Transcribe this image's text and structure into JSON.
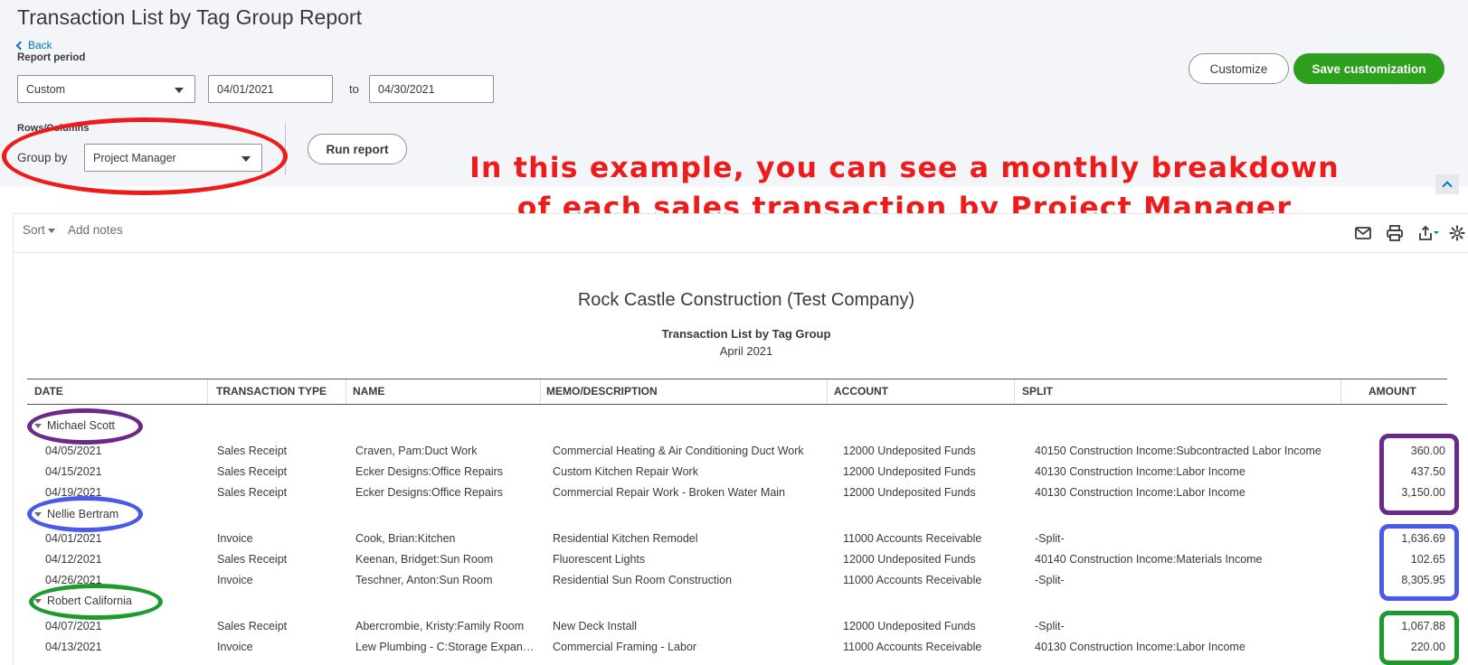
{
  "page": {
    "title": "Transaction List by Tag Group Report",
    "back_label": "Back",
    "report_period_label": "Report period",
    "period_select": "Custom",
    "date_from": "04/01/2021",
    "date_to": "04/30/2021",
    "to_label": "to",
    "rows_columns_label": "Rows/Columns",
    "group_by_label": "Group by",
    "group_by_value": "Project Manager",
    "run_report_label": "Run report",
    "customize_label": "Customize",
    "save_customization_label": "Save customization"
  },
  "annotation": {
    "line1": "In this example, you can see a monthly breakdown",
    "line2": "of each sales transaction by Project Manager",
    "color": "#ee1b1b"
  },
  "toolbar": {
    "sort_label": "Sort",
    "add_notes_label": "Add notes",
    "icons": [
      "email-icon",
      "print-icon",
      "export-icon",
      "settings-icon"
    ]
  },
  "report": {
    "company": "Rock Castle Construction (Test Company)",
    "title": "Transaction List by Tag Group",
    "period": "April 2021",
    "columns": [
      "DATE",
      "TRANSACTION TYPE",
      "NAME",
      "MEMO/DESCRIPTION",
      "ACCOUNT",
      "SPLIT",
      "AMOUNT"
    ],
    "groups": [
      {
        "name": "Michael Scott",
        "color": "#6a2a8c",
        "rows": [
          {
            "date": "04/05/2021",
            "type": "Sales Receipt",
            "name": "Craven, Pam:Duct Work",
            "memo": "Commercial Heating & Air Conditioning Duct Work",
            "account": "12000 Undeposited Funds",
            "split": "40150 Construction Income:Subcontracted Labor Income",
            "amount": "360.00"
          },
          {
            "date": "04/15/2021",
            "type": "Sales Receipt",
            "name": "Ecker Designs:Office Repairs",
            "memo": "Custom Kitchen Repair Work",
            "account": "12000 Undeposited Funds",
            "split": "40130 Construction Income:Labor Income",
            "amount": "437.50"
          },
          {
            "date": "04/19/2021",
            "type": "Sales Receipt",
            "name": "Ecker Designs:Office Repairs",
            "memo": "Commercial Repair Work - Broken Water Main",
            "account": "12000 Undeposited Funds",
            "split": "40130 Construction Income:Labor Income",
            "amount": "3,150.00"
          }
        ]
      },
      {
        "name": "Nellie Bertram",
        "color": "#4a5ae8",
        "rows": [
          {
            "date": "04/01/2021",
            "type": "Invoice",
            "name": "Cook, Brian:Kitchen",
            "memo": "Residential Kitchen Remodel",
            "account": "11000 Accounts Receivable",
            "split": "-Split-",
            "amount": "1,636.69"
          },
          {
            "date": "04/12/2021",
            "type": "Sales Receipt",
            "name": "Keenan, Bridget:Sun Room",
            "memo": "Fluorescent Lights",
            "account": "12000 Undeposited Funds",
            "split": "40140 Construction Income:Materials Income",
            "amount": "102.65"
          },
          {
            "date": "04/26/2021",
            "type": "Invoice",
            "name": "Teschner, Anton:Sun Room",
            "memo": "Residential Sun Room Construction",
            "account": "11000 Accounts Receivable",
            "split": "-Split-",
            "amount": "8,305.95"
          }
        ]
      },
      {
        "name": "Robert California",
        "color": "#1e9a2e",
        "rows": [
          {
            "date": "04/07/2021",
            "type": "Sales Receipt",
            "name": "Abercrombie, Kristy:Family Room",
            "memo": "New Deck Install",
            "account": "12000 Undeposited Funds",
            "split": "-Split-",
            "amount": "1,067.88"
          },
          {
            "date": "04/13/2021",
            "type": "Invoice",
            "name": "Lew Plumbing - C:Storage Expan…",
            "memo": "Commercial Framing - Labor",
            "account": "11000 Accounts Receivable",
            "split": "40130 Construction Income:Labor Income",
            "amount": "220.00"
          }
        ]
      }
    ]
  },
  "colors": {
    "accent_green": "#2ca01c",
    "link_blue": "#0077c5",
    "highlight_red": "#ee1b1b"
  }
}
